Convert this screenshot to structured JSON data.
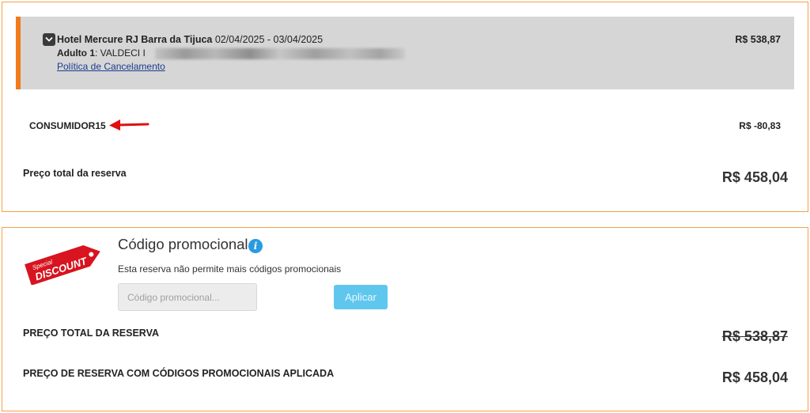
{
  "booking": {
    "hotel_name": "Hotel Mercure RJ Barra da Tijuca",
    "dates": "02/04/2025 - 03/04/2025",
    "guest_label": "Adulto 1",
    "guest_name": ": VALDECI I",
    "cancellation_link": "Política de Cancelamento",
    "price": "R$ 538,87"
  },
  "coupon": {
    "code": "CONSUMIDOR15",
    "discount": "R$ -80,83"
  },
  "summary": {
    "total_label": "Preço total da reserva",
    "total_value": "R$ 458,04"
  },
  "promo": {
    "badge_top": "Special",
    "badge_main": "DISCOUNT",
    "title": "Código promocional",
    "info_icon": "i",
    "note": "Esta reserva não permite mais códigos promocionais",
    "input_placeholder": "Código promocional...",
    "apply_label": "Aplicar",
    "original_total_label": "PREÇO TOTAL DA RESERVA",
    "original_total_value": "R$ 538,87",
    "discounted_total_label": "PREÇO DE RESERVA COM CÓDIGOS PROMOCIONAIS APLICADA",
    "discounted_total_value": "R$ 458,04"
  },
  "colors": {
    "card_border": "#f5a04a",
    "booking_accent": "#f27a1a",
    "booking_bg": "#d6d6d6",
    "arrow": "#e01010",
    "badge": "#d7141f",
    "info": "#2a9be0",
    "apply_button": "#5fc7ee"
  },
  "icons": {
    "collapse": "chevron-down-icon",
    "arrow": "red-arrow-left-icon",
    "badge": "special-discount-tag-icon",
    "info": "info-icon"
  }
}
